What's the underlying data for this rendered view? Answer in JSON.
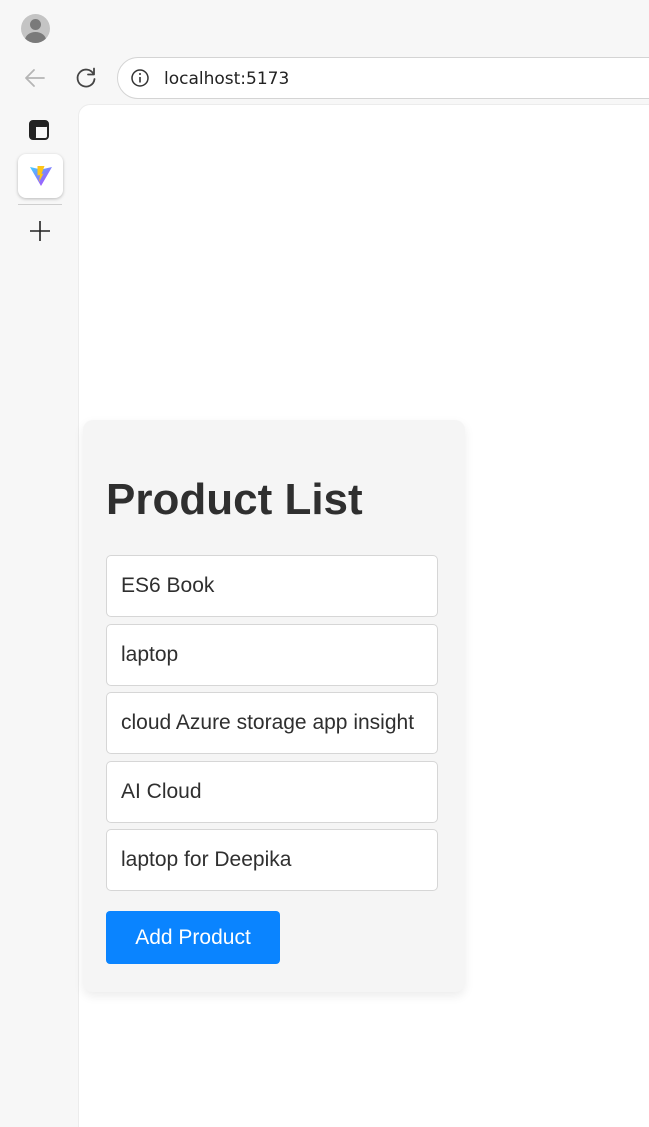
{
  "browser": {
    "address_bar": {
      "url": "localhost:5173"
    }
  },
  "page": {
    "title": "Product List",
    "products": [
      "ES6 Book",
      "laptop",
      "cloud Azure storage app insight",
      "AI Cloud",
      "laptop for Deepika"
    ],
    "add_button_label": "Add Product"
  },
  "colors": {
    "accent": "#0a84ff",
    "card_background": "#f5f5f5",
    "text": "#2f2f2f"
  },
  "icons": {
    "profile": "avatar-icon",
    "back": "back-arrow-icon",
    "reload": "reload-icon",
    "site_info": "info-icon",
    "sidebar": "sidebar-panel-icon",
    "tab_favicon": "vite-logo-icon",
    "new_tab": "plus-icon"
  }
}
